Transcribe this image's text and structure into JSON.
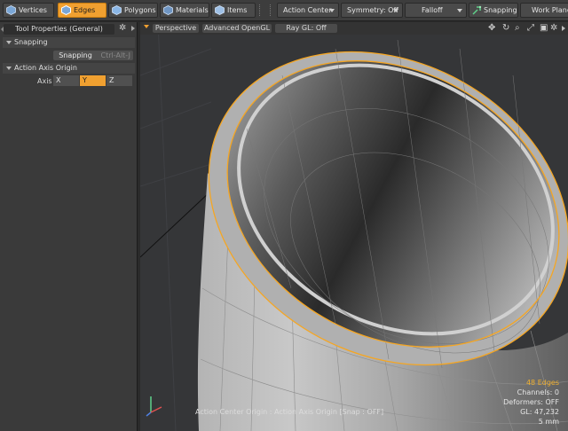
{
  "toolbar": {
    "modes": [
      {
        "label": "Vertices",
        "icon": "vertices-icon",
        "active": false
      },
      {
        "label": "Edges",
        "icon": "edges-icon",
        "active": true
      },
      {
        "label": "Polygons",
        "icon": "polygons-icon",
        "active": false
      },
      {
        "label": "Materials",
        "icon": "materials-icon",
        "active": false
      },
      {
        "label": "Items",
        "icon": "items-icon",
        "active": false
      }
    ],
    "action_center": "Action Center",
    "symmetry": "Symmetry: Off",
    "falloff": "Falloff",
    "snapping": "Snapping",
    "work_plane": "Work Plane"
  },
  "panel": {
    "tab_title": "Tool Properties (General)",
    "snapping_section": "Snapping",
    "snapping_button": "Snapping",
    "snapping_hotkey": "Ctrl-Alt-J",
    "axis_section": "Action Axis Origin",
    "axis_label": "Axis",
    "axis_options": [
      "X",
      "Y",
      "Z"
    ],
    "axis_selected": "Y"
  },
  "viewport": {
    "view_mode": "Perspective",
    "renderer": "Advanced OpenGL",
    "ray_gl": "Ray GL: Off",
    "selection_count": "48 Edges",
    "channels": "Channels: 0",
    "deformers": "Deformers: OFF",
    "gl_count": "GL: 47,232",
    "grid_size": "5 mm",
    "status": "Action Center Origin : Action Axis Origin  [Snap : OFF]"
  },
  "colors": {
    "accent": "#f0a030",
    "selection_edge": "#f5a623",
    "info_highlight": "#f0b030"
  }
}
